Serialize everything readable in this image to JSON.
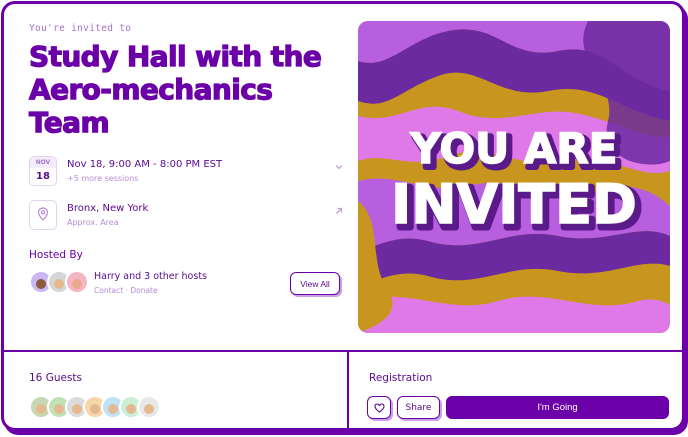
{
  "invite": {
    "label": "You're invited to",
    "title": "Study Hall with the Aero-mechanics Team"
  },
  "schedule": {
    "month": "NOV",
    "day": "18",
    "time": "Nov 18, 9:00 AM - 8:00 PM EST",
    "sessions": "+5 more sessions",
    "icon": "chevron-down-icon"
  },
  "location": {
    "name": "Bronx, New York",
    "area": "Approx. Area",
    "icon": "map-pin-icon",
    "link_icon": "arrow-up-right-icon"
  },
  "hosts": {
    "heading": "Hosted By",
    "summary": "Harry and 3 other hosts",
    "links": "Contact · Donate",
    "view_all": "View All",
    "avatar_colors": [
      "#c9b6f2",
      "#d6d6d6",
      "#f6b5c6"
    ]
  },
  "art": {
    "line1": "YOU ARE",
    "line2": "INVITED",
    "colors": [
      "#c8961e",
      "#b85fe0",
      "#6b2aa0",
      "#e079e8"
    ]
  },
  "guests": {
    "heading": "16 Guests",
    "avatar_colors": [
      "#c8d7b3",
      "#bfe3b5",
      "#dcdcdc",
      "#f5d7a8",
      "#bde3f5",
      "#c9f0d6",
      "#e8e8e8"
    ]
  },
  "registration": {
    "heading": "Registration",
    "heart_icon": "heart-icon",
    "share": "Share",
    "going": "I'm Going"
  },
  "colors": {
    "brand": "#6b00a8",
    "muted": "#b58bd4"
  }
}
